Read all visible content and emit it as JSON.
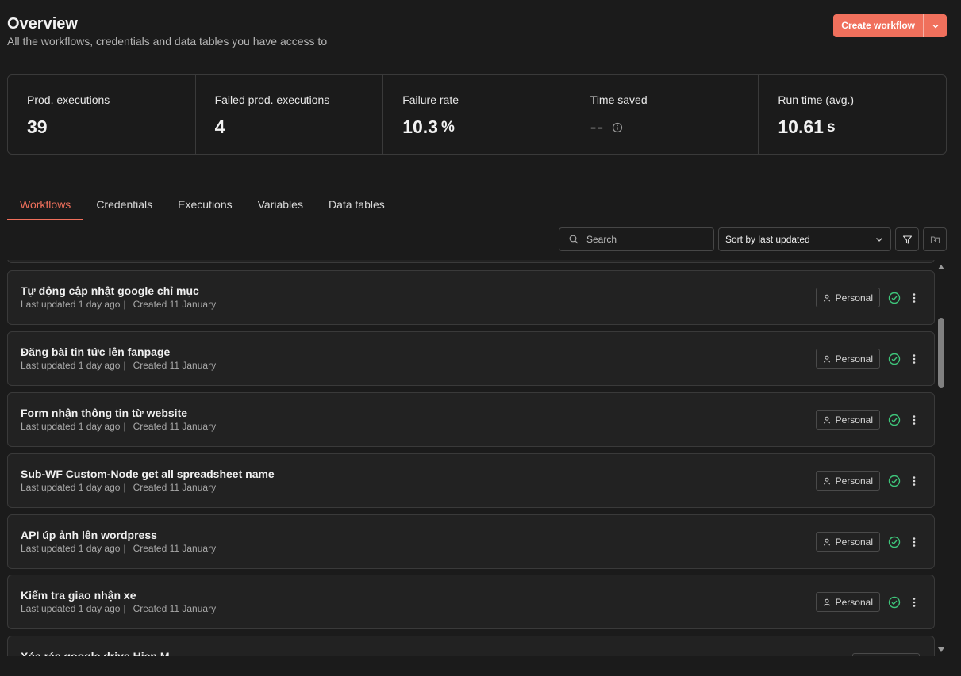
{
  "header": {
    "title": "Overview",
    "subtitle": "All the workflows, credentials and data tables you have access to",
    "create_label": "Create workflow"
  },
  "stats": [
    {
      "label": "Prod. executions",
      "value": "39",
      "unit": ""
    },
    {
      "label": "Failed prod. executions",
      "value": "4",
      "unit": ""
    },
    {
      "label": "Failure rate",
      "value": "10.3",
      "unit": "%"
    },
    {
      "label": "Time saved",
      "value": "--",
      "unit": ""
    },
    {
      "label": "Run time (avg.)",
      "value": "10.61",
      "unit": "s"
    }
  ],
  "tabs": [
    "Workflows",
    "Credentials",
    "Executions",
    "Variables",
    "Data tables"
  ],
  "active_tab": "Workflows",
  "toolbar": {
    "search_placeholder": "Search",
    "sort_label": "Sort by last updated"
  },
  "workflows": [
    {
      "name": "Tự động cập nhật google chỉ mục",
      "updated": "Last updated 1 day ago",
      "created": "Created 11 January",
      "owner": "Personal"
    },
    {
      "name": "Đăng bài tin tức lên fanpage",
      "updated": "Last updated 1 day ago",
      "created": "Created 11 January",
      "owner": "Personal"
    },
    {
      "name": "Form nhận thông tin từ website",
      "updated": "Last updated 1 day ago",
      "created": "Created 11 January",
      "owner": "Personal"
    },
    {
      "name": "Sub-WF Custom-Node get all spreadsheet name",
      "updated": "Last updated 1 day ago",
      "created": "Created 11 January",
      "owner": "Personal"
    },
    {
      "name": "API úp ảnh lên wordpress",
      "updated": "Last updated 1 day ago",
      "created": "Created 11 January",
      "owner": "Personal"
    },
    {
      "name": "Kiểm tra giao nhận xe",
      "updated": "Last updated 1 day ago",
      "created": "Created 11 January",
      "owner": "Personal"
    },
    {
      "name": "Xóa rác google drive Hien M",
      "updated": "",
      "created": "",
      "owner": ""
    }
  ],
  "colors": {
    "accent": "#f0705c",
    "background": "#1b1b1b",
    "card": "#222222",
    "border": "#3a3a3a",
    "success": "#3ec57a"
  }
}
